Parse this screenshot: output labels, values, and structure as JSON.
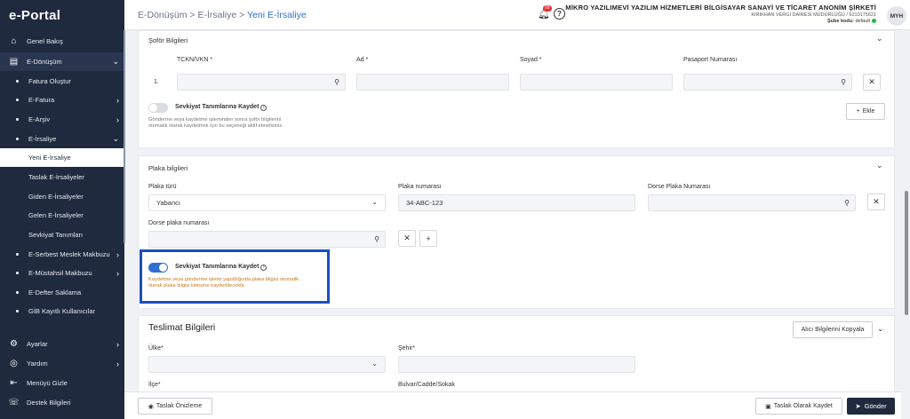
{
  "app": {
    "logo": "e-Portal"
  },
  "sidebar": {
    "items": [
      {
        "label": "Genel Bakış",
        "icon": "home-icon"
      },
      {
        "label": "E-Dönüşüm",
        "icon": "document-icon"
      },
      {
        "label": "Fatura Oluştur"
      },
      {
        "label": "E-Fatura"
      },
      {
        "label": "E-Arşiv"
      },
      {
        "label": "E-İrsaliye"
      },
      {
        "label": "Yeni E-İrsaliye"
      },
      {
        "label": "Taslak E-İrsaliyeler"
      },
      {
        "label": "Giden E-İrsaliyeler"
      },
      {
        "label": "Gelen E-İrsaliyeler"
      },
      {
        "label": "Sevkiyat Tanımları"
      },
      {
        "label": "E-Serbest Meslek Makbuzu"
      },
      {
        "label": "E-Müstahsil Makbuzu"
      },
      {
        "label": "E-Defter Saklama"
      },
      {
        "label": "GİB Kayıtlı Kullanıcılar"
      },
      {
        "label": "Ayarlar",
        "icon": "gear-icon"
      },
      {
        "label": "Yardım",
        "icon": "help-icon"
      },
      {
        "label": "Menüyü Gizle",
        "icon": "collapse-menu-icon"
      },
      {
        "label": "Destek Bilgileri",
        "icon": "support-icon"
      }
    ]
  },
  "header": {
    "breadcrumb": {
      "part1": "E-Dönüşüm",
      "sep": ">",
      "part2": "E-İrsaliye",
      "current": "Yeni E-İrsaliye"
    },
    "notification_count": "99",
    "company_name": "MİKRO YAZILIMEVİ YAZILIM HİZMETLERİ BİLGİSAYAR SANAYİ VE TİCARET ANONİM ŞİRKETİ",
    "tax_info": "KIRIKHAN VERGİ DAİRESİ MÜDÜRLÜĞÜ / 6210175621",
    "branch_label": "Şube kodu:",
    "branch_value": "default",
    "avatar": "MYH"
  },
  "driver": {
    "title": "Şoför Bilgileri",
    "col_tckn": "TCKN/VKN *",
    "col_ad": "Ad *",
    "col_soyad": "Soyad *",
    "col_pasaport": "Pasaport Numarası",
    "row_number": "1.",
    "toggle_label": "Sevkiyat Tanımlarına Kaydet",
    "hint_line1": "Gönderme veya kaydetme işleminden sonra şoför bilgilerini",
    "hint_line2": "otomatik olarak kaydetmek için bu seçeneği aktif etmelisiniz.",
    "add_label": "Ekle"
  },
  "plate": {
    "title": "Plaka bilgileri",
    "type_label": "Plaka türü",
    "type_value": "Yabancı",
    "number_label": "Plaka numarası",
    "number_value": "34-ABC-123",
    "trailer_label": "Dorse Plaka Numarası",
    "trailer2_label": "Dorse plaka numarası",
    "toggle_label": "Sevkiyat Tanımlarına Kaydet",
    "hint_line1": "Kaydetme veya gönderme işlemi yapıldığında plaka bilgisi otomatik",
    "hint_line2": "olarak plaka bilgisi listesine kaydedilecektir."
  },
  "delivery": {
    "title": "Teslimat Bilgileri",
    "copy_button": "Alıcı Bilgilerini Kopyala",
    "country_label": "Ülke*",
    "city_label": "Şehir*",
    "district_label": "İlçe*",
    "street_label": "Bulvar/Cadde/Sokak"
  },
  "footer": {
    "preview_label": "Taslak Önizleme",
    "save_draft_label": "Taslak Olarak Kaydet",
    "send_label": "Gönder"
  },
  "colors": {
    "sidebar_bg": "#1f2a3f",
    "accent_blue": "#2f6fd3",
    "highlight_border": "#1a4fc2",
    "warn_text": "#c37a1e"
  }
}
